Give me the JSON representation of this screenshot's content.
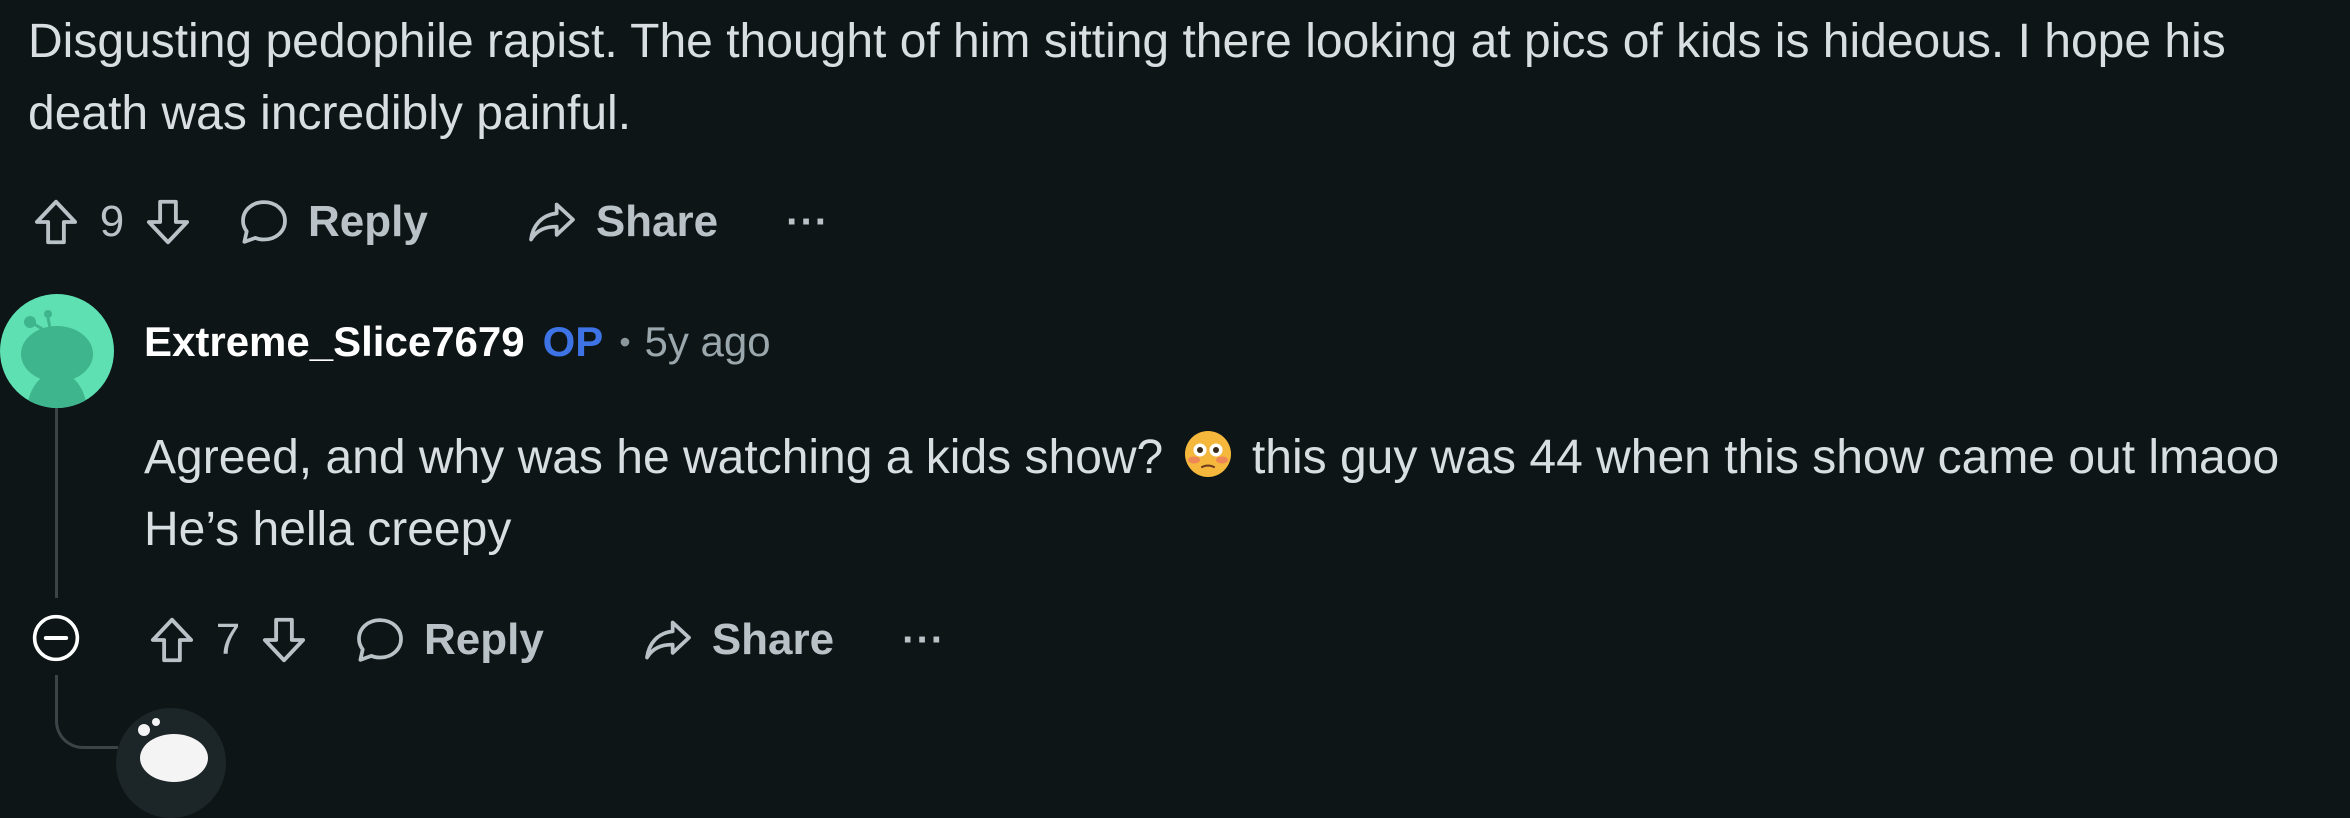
{
  "comment1": {
    "text_line1": "Disgusting pedophile rapist. The thought of him sitting there looking at pics of kids is hideous. I hope his",
    "text_line2": "death was incredibly painful.",
    "score": "9",
    "reply_label": "Reply",
    "share_label": "Share",
    "more_label": "···"
  },
  "comment2": {
    "username": "Extreme_Slice7679",
    "op_badge": "OP",
    "separator": "•",
    "timestamp": "5y ago",
    "text_line1_before": "Agreed, and why was he watching a kids show?",
    "emoji": "flushed-face-emoji",
    "text_line1_after": "this guy was 44 when this show came out lmaoo",
    "text_line2": "He’s hella creepy",
    "score": "7",
    "reply_label": "Reply",
    "share_label": "Share",
    "more_label": "···"
  },
  "icons": {
    "upvote": "upvote-arrow-icon",
    "downvote": "downvote-arrow-icon",
    "reply": "speech-bubble-icon",
    "share": "share-arrow-icon",
    "collapse": "collapse-minus-icon",
    "avatar": "snoo-avatar-icon"
  },
  "colors": {
    "background": "#0d1517",
    "text": "#d8dee1",
    "muted": "#b8c2c7",
    "op_badge": "#3e73e6",
    "avatar_bg": "#5fe0b2"
  }
}
